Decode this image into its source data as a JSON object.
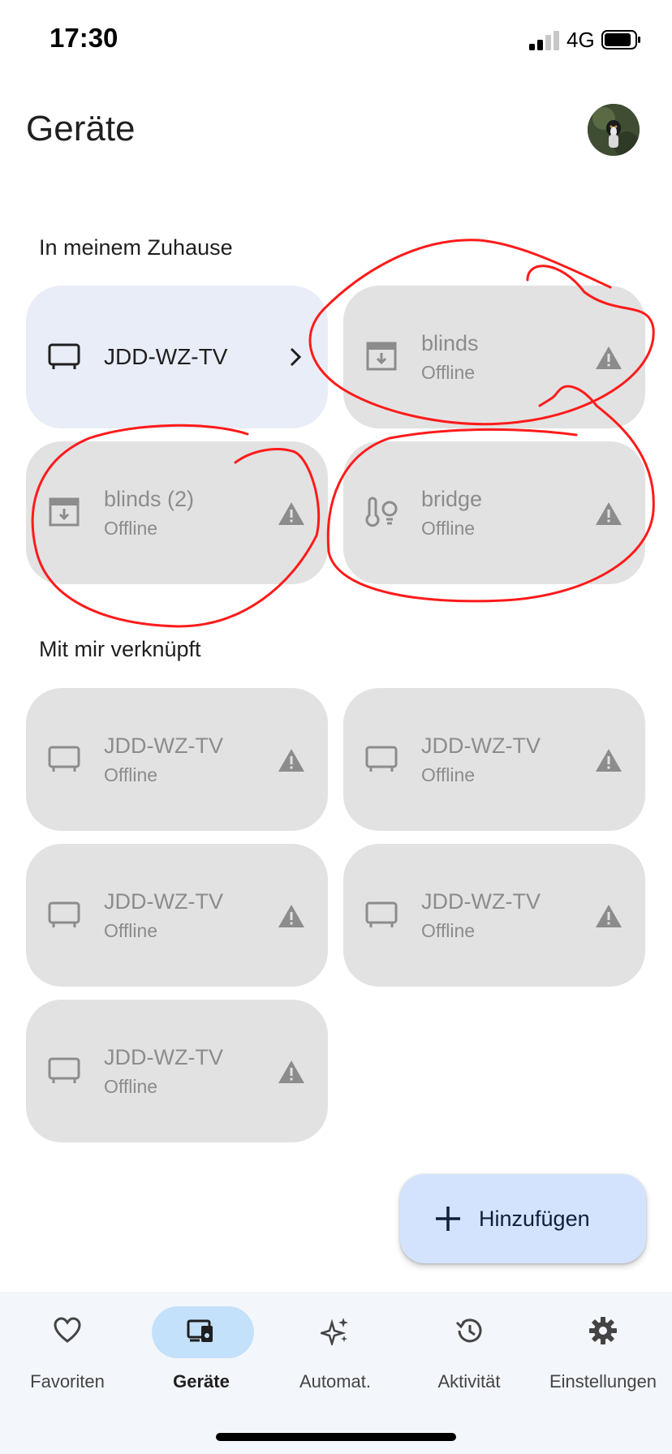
{
  "status_bar": {
    "time": "17:30",
    "network": "4G"
  },
  "header": {
    "title": "Geräte"
  },
  "sections": {
    "home": {
      "title": "In meinem Zuhause",
      "devices": [
        {
          "name": "JDD-WZ-TV",
          "status": "",
          "icon": "tv-icon",
          "state": "online"
        },
        {
          "name": "blinds",
          "status": "Offline",
          "icon": "blinds-icon",
          "state": "offline"
        },
        {
          "name": "blinds (2)",
          "status": "Offline",
          "icon": "blinds-icon",
          "state": "offline"
        },
        {
          "name": "bridge",
          "status": "Offline",
          "icon": "sensor-light-icon",
          "state": "offline"
        }
      ]
    },
    "linked": {
      "title": "Mit mir verknüpft",
      "devices": [
        {
          "name": "JDD-WZ-TV",
          "status": "Offline",
          "icon": "tv-icon",
          "state": "offline"
        },
        {
          "name": "JDD-WZ-TV",
          "status": "Offline",
          "icon": "tv-icon",
          "state": "offline"
        },
        {
          "name": "JDD-WZ-TV",
          "status": "Offline",
          "icon": "tv-icon",
          "state": "offline"
        },
        {
          "name": "JDD-WZ-TV",
          "status": "Offline",
          "icon": "tv-icon",
          "state": "offline"
        },
        {
          "name": "JDD-WZ-TV",
          "status": "Offline",
          "icon": "tv-icon",
          "state": "offline"
        }
      ]
    }
  },
  "fab": {
    "label": "Hinzufügen",
    "icon": "plus-icon"
  },
  "bottom_nav": [
    {
      "label": "Favoriten",
      "icon": "heart-icon",
      "selected": false
    },
    {
      "label": "Geräte",
      "icon": "devices-icon",
      "selected": true
    },
    {
      "label": "Automat.",
      "icon": "sparkle-icon",
      "selected": false
    },
    {
      "label": "Aktivität",
      "icon": "history-icon",
      "selected": false
    },
    {
      "label": "Einstellungen",
      "icon": "gear-icon",
      "selected": false
    }
  ],
  "colors": {
    "offline_tile": "#e2e2e2",
    "active_tile": "#e9edf7",
    "fab": "#d3e3fd",
    "nav_selected": "#c4e1fb",
    "annotation": "#ff1a1a"
  }
}
